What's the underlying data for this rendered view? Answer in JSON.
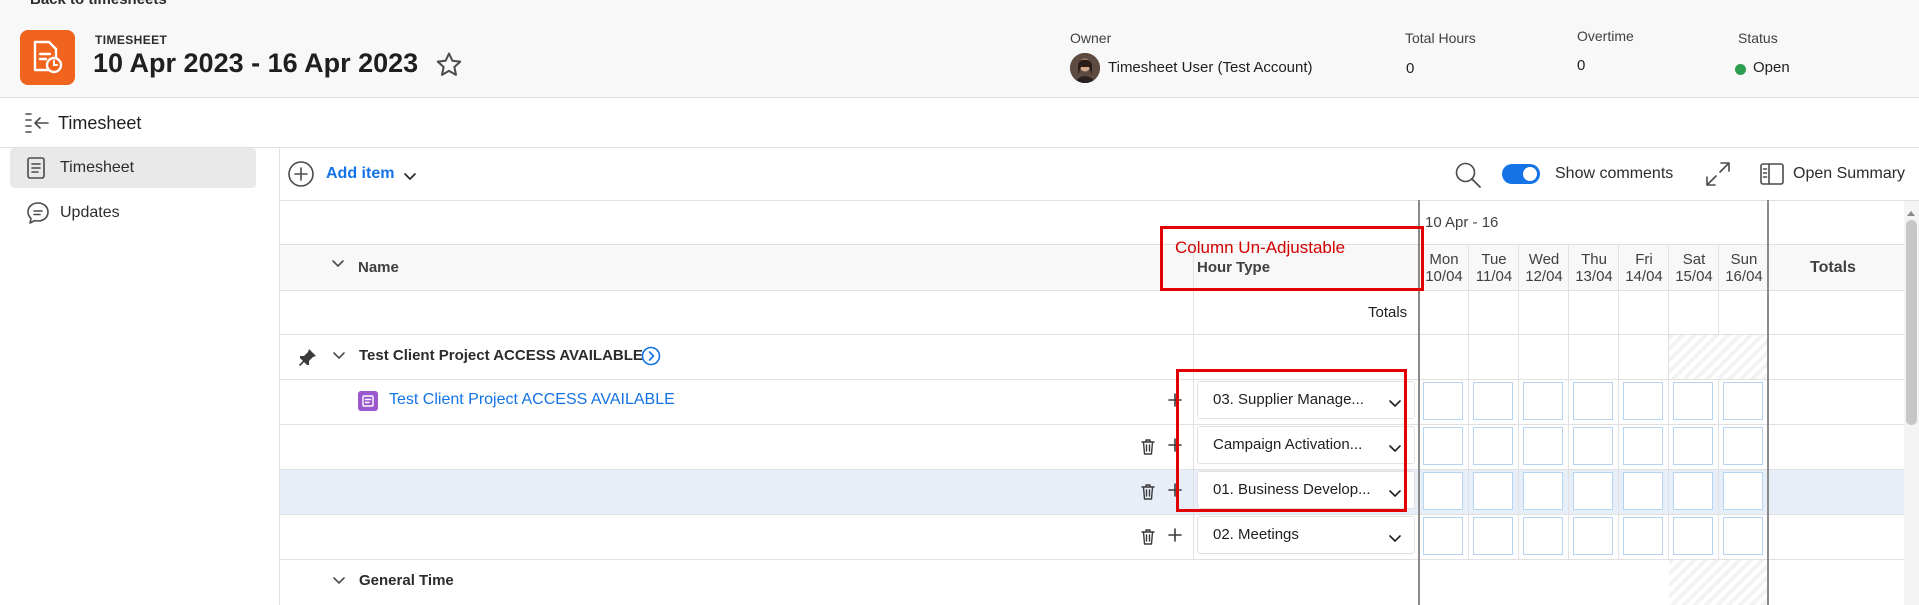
{
  "header": {
    "back_link": "Back to timesheets",
    "kicker": "TIMESHEET",
    "title": "10 Apr 2023 - 16 Apr 2023",
    "owner_label": "Owner",
    "owner_name": "Timesheet User (Test Account)",
    "total_hours_label": "Total Hours",
    "total_hours_value": "0",
    "overtime_label": "Overtime",
    "overtime_value": "0",
    "status_label": "Status",
    "status_value": "Open",
    "brand_color": "#f0641e",
    "status_color": "#2d9d4f"
  },
  "breadcrumb": {
    "title": "Timesheet"
  },
  "sidebar": {
    "items": [
      {
        "label": "Timesheet",
        "icon": "document-icon",
        "active": true
      },
      {
        "label": "Updates",
        "icon": "speech-bubble-icon",
        "active": false
      }
    ]
  },
  "toolbar": {
    "add_item_label": "Add item",
    "show_comments_label": "Show comments",
    "open_summary_label": "Open Summary",
    "accent_color": "#1473e6"
  },
  "grid": {
    "week_label": "10 Apr - 16",
    "name_header": "Name",
    "hour_type_header": "Hour Type",
    "totals_header": "Totals",
    "totals_row_label": "Totals",
    "days": [
      {
        "dow": "Mon",
        "date": "10/04"
      },
      {
        "dow": "Tue",
        "date": "11/04"
      },
      {
        "dow": "Wed",
        "date": "12/04"
      },
      {
        "dow": "Thu",
        "date": "13/04"
      },
      {
        "dow": "Fri",
        "date": "14/04"
      },
      {
        "dow": "Sat",
        "date": "15/04"
      },
      {
        "dow": "Sun",
        "date": "16/04"
      }
    ],
    "project_group": "Test Client Project ACCESS AVAILABLE",
    "task_link": "Test Client Project ACCESS AVAILABLE",
    "hour_types": [
      "03. Supplier Manage...",
      "Campaign Activation...",
      "01. Business Develop...",
      "02. Meetings"
    ],
    "general_group": "General Time"
  },
  "annotation": {
    "note": "Column Un-Adjustable",
    "color": "#e30000"
  }
}
